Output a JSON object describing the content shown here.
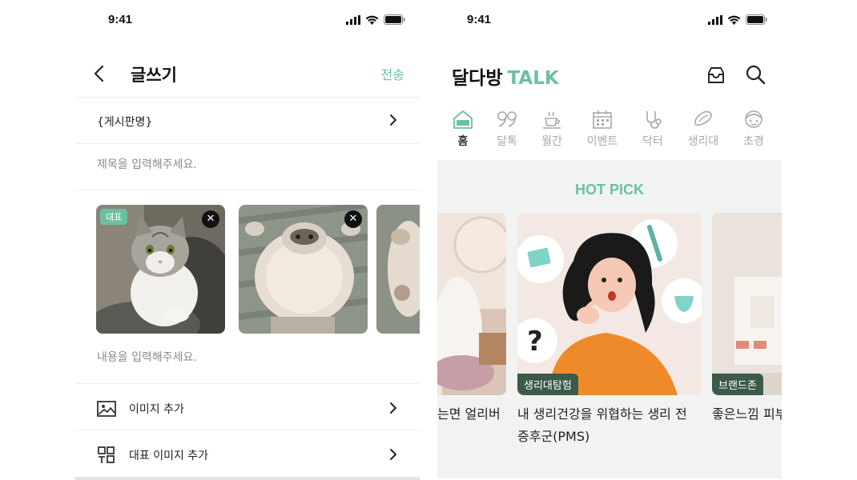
{
  "colors": {
    "accent": "#6cc0a0",
    "tag_bg": "#3c5a4a",
    "section_bg": "#f1f3f3"
  },
  "left": {
    "status": {
      "time": "9:41"
    },
    "header": {
      "title": "글쓰기",
      "send_label": "전송"
    },
    "board": {
      "label": "{게시판명}"
    },
    "title_field": {
      "placeholder": "제목을 입력해주세요."
    },
    "images": {
      "rep_badge": "대표",
      "remove_symbol": "✕"
    },
    "content_field": {
      "placeholder": "내용을 입력해주세요."
    },
    "menu": [
      {
        "icon": "image-icon",
        "label": "이미지 추가"
      },
      {
        "icon": "representative-grid-icon",
        "label": "대표 이미지 추가"
      }
    ]
  },
  "right": {
    "status": {
      "time": "9:41"
    },
    "header": {
      "logo_main": "달다방",
      "logo_accent": "TALK"
    },
    "categories": [
      {
        "icon": "home-talk-icon",
        "label": "홈",
        "active": true
      },
      {
        "icon": "quote-icon",
        "label": "달톡"
      },
      {
        "icon": "cup-icon",
        "label": "월간"
      },
      {
        "icon": "calendar-icon",
        "label": "이벤트"
      },
      {
        "icon": "stethoscope-icon",
        "label": "닥터"
      },
      {
        "icon": "pad-icon",
        "label": "생리대"
      },
      {
        "icon": "face-icon",
        "label": "초경"
      }
    ],
    "hot_pick": {
      "title": "HOT PICK",
      "cards": [
        {
          "tag": "",
          "title": "는면 얼리버"
        },
        {
          "tag": "생리대탐험",
          "title": "내 생리건강을 위협하는 생리 전 증후군(PMS)"
        },
        {
          "tag": "브랜드존",
          "title": "좋은느낌 피부 백 체험단 모"
        }
      ]
    }
  }
}
